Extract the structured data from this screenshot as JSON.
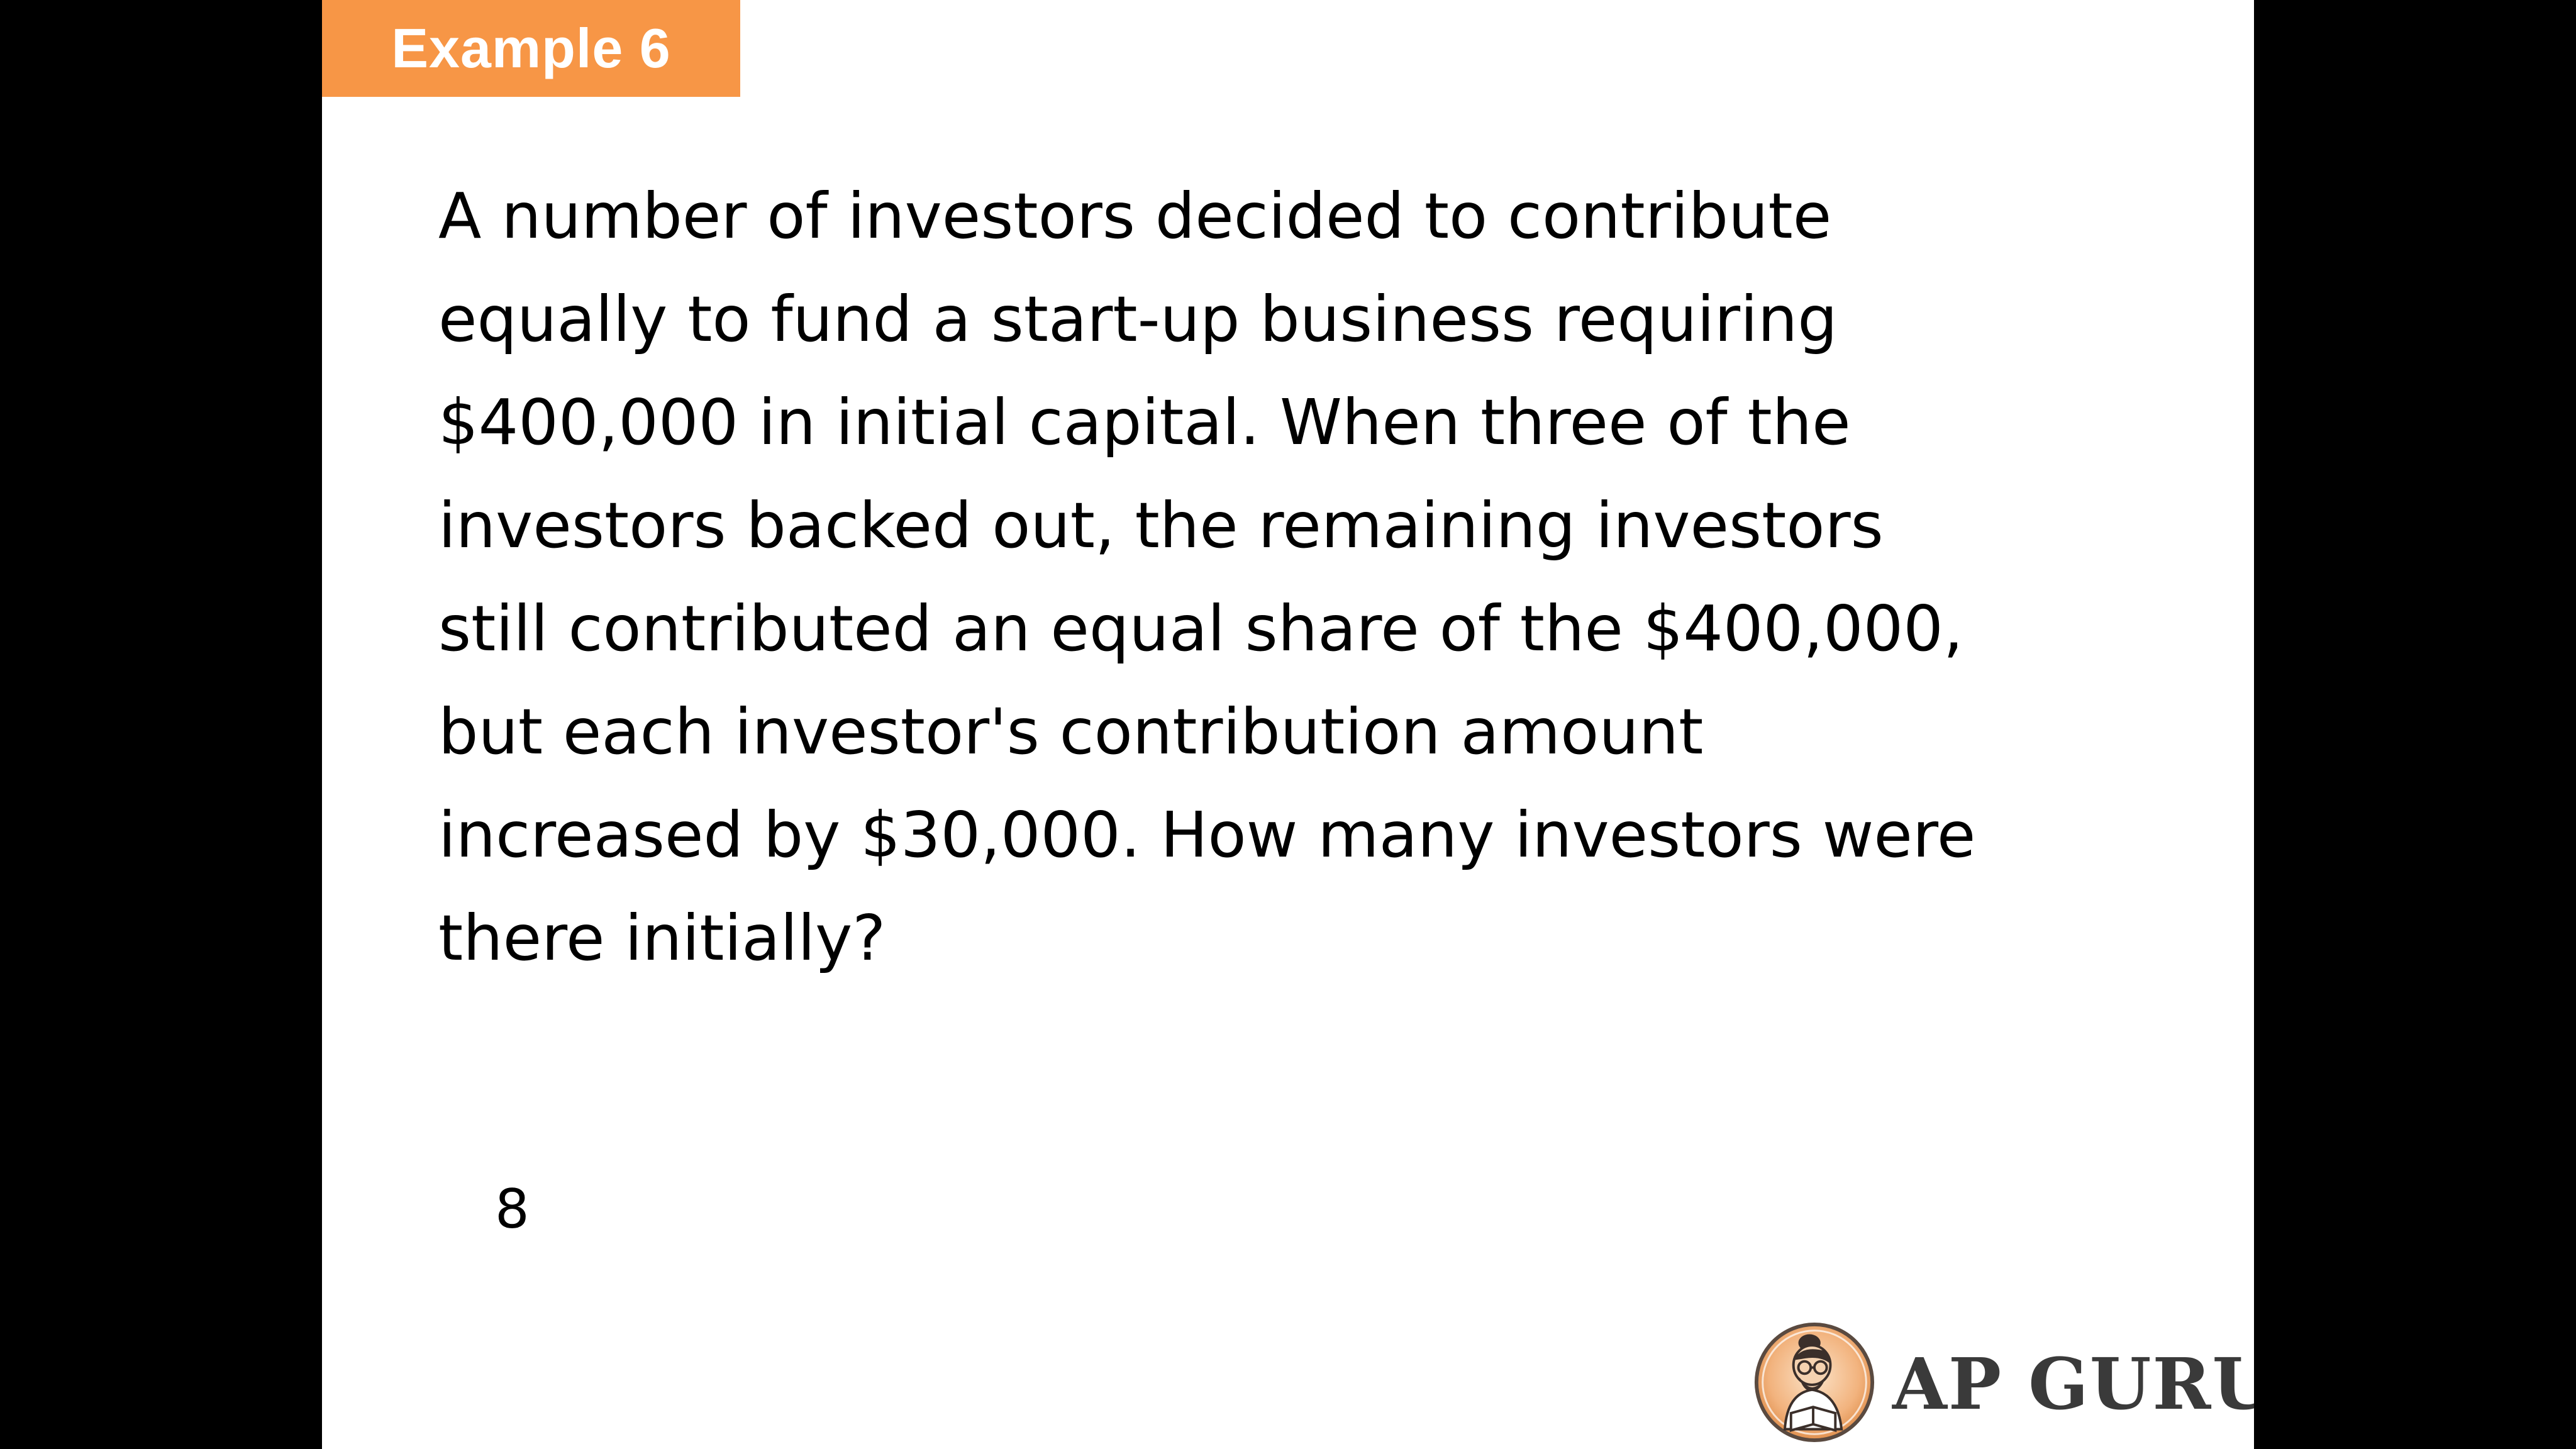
{
  "slide": {
    "tag_label": "Example 6",
    "question_lines": [
      "A number of investors decided to contribute",
      "equally to fund a start-up business requiring",
      "$400,000 in initial capital.  When three of the",
      "investors backed out, the remaining investors",
      "still contributed an equal share of the $400,000,",
      "but each investor's contribution amount",
      "increased by $30,000.  How many investors were",
      "there initially?"
    ],
    "page_number": "8"
  },
  "logo": {
    "text": "AP GURU",
    "icon": "reading-guru-icon"
  },
  "colors": {
    "tag_background": "#F79646",
    "tag_text": "#FFFFFF",
    "background": "#000000",
    "slide": "#FFFFFF",
    "logo_text": "#3A3A3A"
  }
}
